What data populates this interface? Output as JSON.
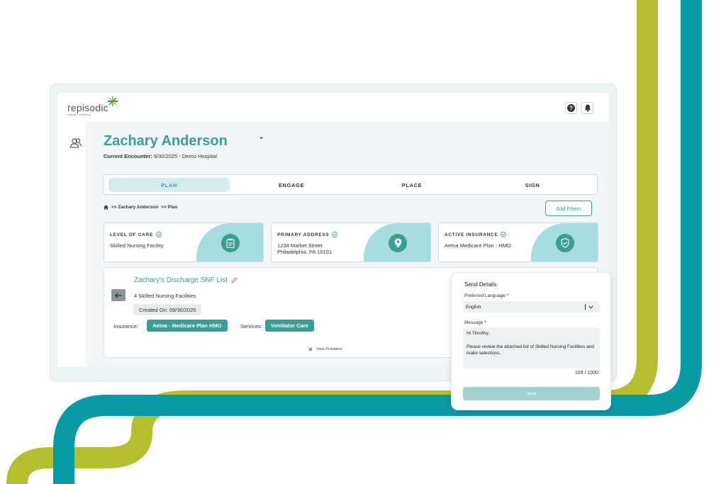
{
  "app": {
    "logo": "repisodic",
    "logo_sub": "change everything"
  },
  "header": {
    "help_icon": "help-icon",
    "bell_icon": "bell-icon"
  },
  "sidebar": {
    "user_icon": "users-icon"
  },
  "patient": {
    "name": "Zachary Anderson",
    "encounter_label": "Current Encounter:",
    "encounter_value": "9/30/2025 - Demo Hospital"
  },
  "steps": [
    "PLAN",
    "ENGAGE",
    "PLACE",
    "SIGN"
  ],
  "breadcrumb": {
    "patient": ">> Zachary Anderson",
    "page": ">> Plan"
  },
  "filters_button": "Add Filters",
  "cards": [
    {
      "label": "LEVEL OF CARE",
      "value": "Skilled Nursing Facility",
      "icon": "clipboard-icon"
    },
    {
      "label": "PRIMARY ADDRESS",
      "value": "1234 Market Street",
      "value2": "Philadelphia, PA 10101",
      "icon": "location-pin-icon"
    },
    {
      "label": "ACTIVE INSURANCE",
      "value": "Aetna Medicare Plan - HMO",
      "icon": "shield-check-icon"
    }
  ],
  "list": {
    "title": "Zachary's Discharge SNF List",
    "count": "4 Skilled Nursing Facilities",
    "created": "Created On:  09/30/2025",
    "insurance_label": "Insurance:",
    "insurance_value": "Aetna - Medicare Plan HMO",
    "services_label": "Services:",
    "services_value": "Ventilator Care",
    "view_providers": "View Providers"
  },
  "send": {
    "title": "Send Details",
    "language_label": "Preferred Language *",
    "language_value": "English",
    "message_label": "Message *",
    "message_line1": "Hi Timothy,",
    "message_line2": "Please review the attached list of Skilled Nursing Facilities and make selections.",
    "char_count": "109 / 1000",
    "button": "Send"
  },
  "colors": {
    "teal": "#3b9e95",
    "light_teal": "#a7dde0",
    "ribbon_teal": "#0a9aa6",
    "ribbon_green": "#b3bf2e"
  }
}
